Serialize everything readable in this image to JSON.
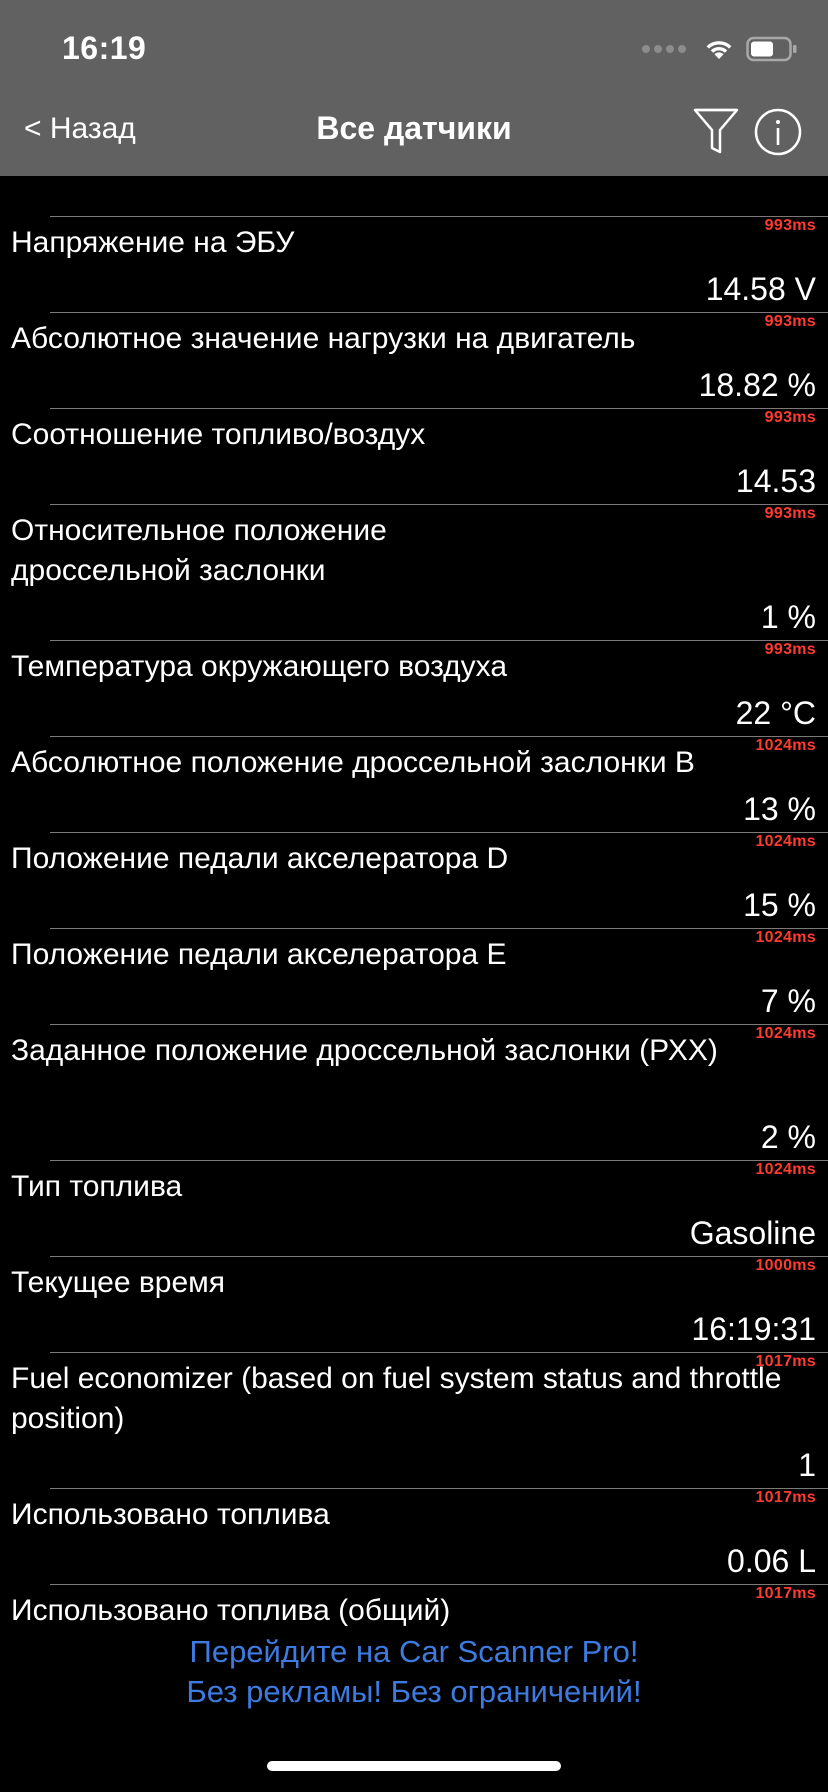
{
  "status_bar": {
    "time": "16:19"
  },
  "nav": {
    "back_label": "< Назад",
    "title": "Все датчики"
  },
  "sensors": [
    {
      "name": "Напряжение на ЭБУ",
      "value": "14.58 V",
      "ms": "993ms"
    },
    {
      "name": "Абсолютное значение нагрузки на двигатель",
      "value": "18.82 %",
      "ms": "993ms"
    },
    {
      "name": "Соотношение топливо/воздух",
      "value": "14.53",
      "ms": "993ms"
    },
    {
      "name": "Относительное положение дроссельной заслонки",
      "value": "1 %",
      "ms": "993ms"
    },
    {
      "name": "Температура окружающего воздуха",
      "value": "22 °C",
      "ms": "993ms"
    },
    {
      "name": "Абсолютное положение дроссельной заслонки B",
      "value": "13 %",
      "ms": "1024ms"
    },
    {
      "name": "Положение педали акселератора D",
      "value": "15 %",
      "ms": "1024ms"
    },
    {
      "name": "Положение педали акселератора E",
      "value": "7 %",
      "ms": "1024ms"
    },
    {
      "name": "Заданное положение дроссельной заслонки (РХХ)",
      "value": "2 %",
      "ms": "1024ms"
    },
    {
      "name": "Тип топлива",
      "value": "Gasoline",
      "ms": "1024ms"
    },
    {
      "name": "Текущее время",
      "value": "16:19:31",
      "ms": "1000ms"
    },
    {
      "name": "Fuel economizer (based on fuel system status and throttle position)",
      "value": "1",
      "ms": "1017ms"
    },
    {
      "name": "Использовано топлива",
      "value": "0.06 L",
      "ms": "1017ms"
    },
    {
      "name": "Использовано топлива (общий)",
      "value": "",
      "ms": "1017ms"
    }
  ],
  "promo": {
    "line1": "Перейдите на Car Scanner Pro!",
    "line2": "Без рекламы! Без ограничений!"
  },
  "colors": {
    "nav_bg": "#616161",
    "latency": "#ff3b30",
    "promo": "#3d7be0"
  }
}
